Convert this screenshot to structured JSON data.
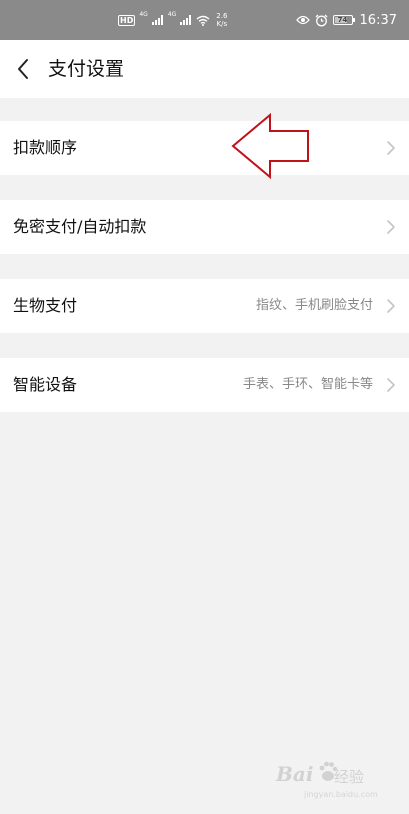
{
  "status_bar": {
    "hd_label": "HD",
    "signal1_label": "4G",
    "signal2_label": "4G",
    "speed_value": "2.6",
    "speed_unit": "K/s",
    "battery": "74",
    "time": "16:37",
    "icons": [
      "eye-icon",
      "alarm-icon",
      "wifi-icon",
      "signal-icon",
      "battery-icon"
    ]
  },
  "header": {
    "title": "支付设置",
    "back_icon": "chevron-left-icon"
  },
  "settings": [
    {
      "label": "扣款顺序",
      "value": ""
    },
    {
      "label": "免密支付/自动扣款",
      "value": ""
    },
    {
      "label": "生物支付",
      "value": "指纹、手机刷脸支付"
    },
    {
      "label": "智能设备",
      "value": "手表、手环、智能卡等"
    }
  ],
  "annotation": {
    "icon": "red-arrow-left-icon",
    "color": "#c0121a"
  },
  "watermark": {
    "brand": "Bai",
    "suffix": "经验",
    "url": "jingyan.baidu.com"
  },
  "colors": {
    "status_bar_bg": "#8a8a8a",
    "page_bg": "#f2f2f2",
    "row_bg": "#ffffff",
    "secondary_text": "#888888",
    "chevron": "#c4c4c4"
  }
}
